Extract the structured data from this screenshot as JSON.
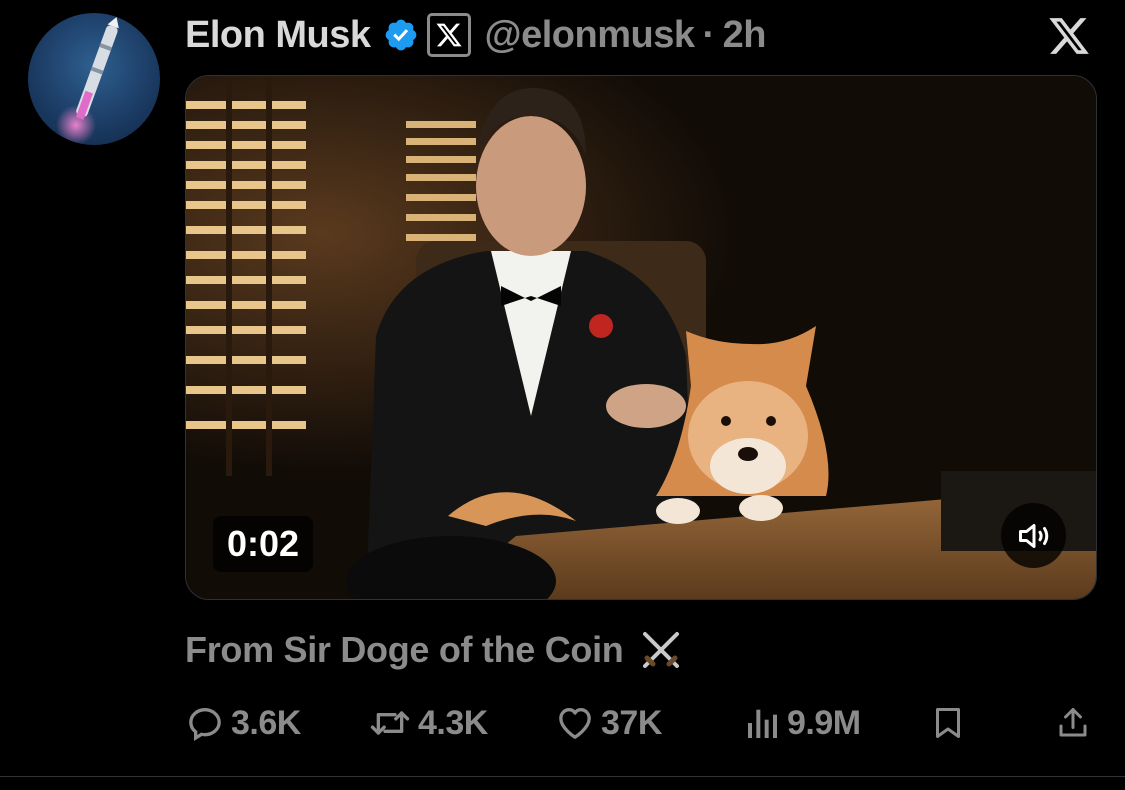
{
  "author": {
    "name": "Elon Musk",
    "handle": "@elonmusk",
    "separator": "·",
    "time": "2h"
  },
  "media": {
    "duration": "0:02"
  },
  "tweet": {
    "text": "From Sir Doge of the Coin"
  },
  "stats": {
    "replies": "3.6K",
    "reposts": "4.3K",
    "likes": "37K",
    "views": "9.9M"
  },
  "icons": {
    "verified": "verified-badge-icon",
    "affiliate": "x-affiliate-badge-icon",
    "brand": "x-logo-icon",
    "volume": "speaker-icon",
    "emoji": "crossed-swords-icon",
    "reply": "reply-icon",
    "repost": "repost-icon",
    "like": "heart-icon",
    "views": "views-icon",
    "bookmark": "bookmark-icon",
    "share": "share-icon"
  },
  "colors": {
    "background": "#000000",
    "primary_text": "#d9d9d9",
    "secondary_text": "#8b8b8b",
    "verified_blue": "#1d9bf0",
    "border": "#2f3336"
  }
}
